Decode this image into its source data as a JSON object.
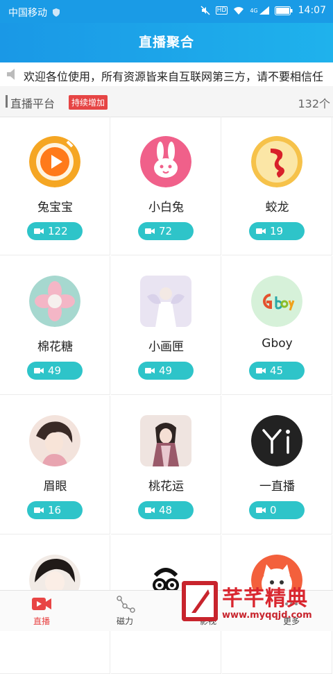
{
  "status_bar": {
    "carrier": "中国移动",
    "hd": "HD",
    "network": "4G",
    "time": "14:07"
  },
  "header": {
    "title": "直播聚合"
  },
  "marquee": {
    "text": "欢迎各位使用，所有资源皆来自互联网第三方，请不要相信任"
  },
  "section": {
    "title": "直播平台",
    "badge": "持续增加",
    "count": "132个"
  },
  "platforms": [
    {
      "name": "兔宝宝",
      "count": "122",
      "icon": "orange-play-icon"
    },
    {
      "name": "小白兔",
      "count": "72",
      "icon": "white-rabbit-icon"
    },
    {
      "name": "蛟龙",
      "count": "19",
      "icon": "dragon-icon"
    },
    {
      "name": "棉花糖",
      "count": "49",
      "icon": "lotus-icon"
    },
    {
      "name": "小画匣",
      "count": "49",
      "icon": "angel-icon"
    },
    {
      "name": "Gboy",
      "count": "45",
      "icon": "gboy-icon"
    },
    {
      "name": "眉眼",
      "count": "16",
      "icon": "portrait-icon"
    },
    {
      "name": "桃花运",
      "count": "48",
      "icon": "figure-icon"
    },
    {
      "name": "一直播",
      "count": "0",
      "icon": "yi-icon"
    }
  ],
  "partial_row": [
    {
      "icon": "portrait-icon"
    },
    {
      "icon": "glasses-cartoon-icon"
    },
    {
      "icon": "cartoon-cat-icon"
    }
  ],
  "bottom_nav": [
    {
      "label": "直播",
      "icon": "live-camera-icon",
      "active": true
    },
    {
      "label": "磁力",
      "icon": "magnet-nodes-icon",
      "active": false
    },
    {
      "label": "影视",
      "icon": "film-icon",
      "active": false
    },
    {
      "label": "更多",
      "icon": "more-icon",
      "active": false
    }
  ],
  "watermark": {
    "title": "芊芊精典",
    "url": "www.myqqjd.com"
  },
  "colors": {
    "primary": "#1a9be6",
    "pill": "#2ec4c9",
    "accent": "#e64545"
  }
}
